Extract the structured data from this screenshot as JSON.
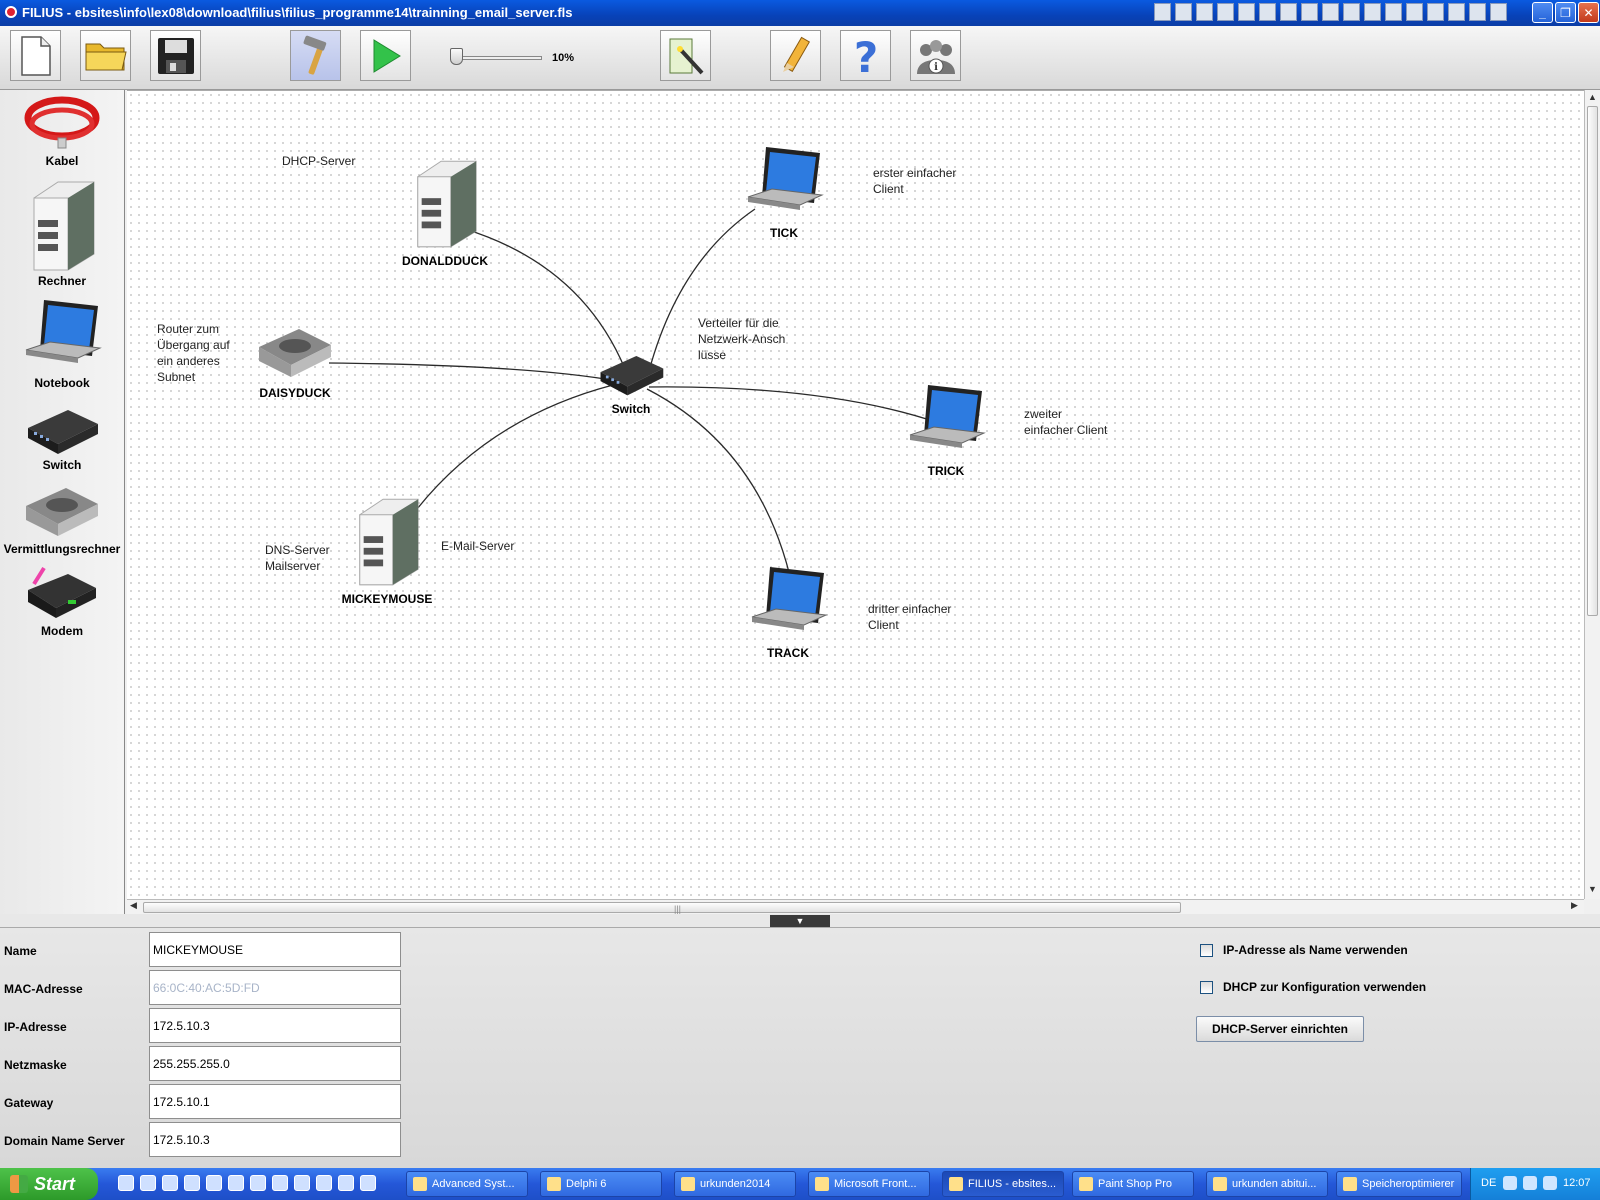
{
  "window": {
    "title": "FILIUS - ebsites\\info\\lex08\\download\\filius\\filius_programme14\\trainning_email_server.fls",
    "buttons": [
      "minimize",
      "maximize",
      "close"
    ]
  },
  "toolbar": {
    "buttons": [
      "new-file-icon",
      "open-folder-icon",
      "save-disk-icon",
      "hammer-design-mode-icon",
      "play-simulation-icon",
      "wizard-wand-icon",
      "pencil-icon",
      "help-question-icon",
      "info-people-icon"
    ],
    "speed_label": "10%",
    "speed_value": 10
  },
  "palette": {
    "items": [
      "Kabel",
      "Rechner",
      "Notebook",
      "Switch",
      "Vermittlungsrechner",
      "Modem"
    ]
  },
  "network": {
    "nodes": {
      "donaldduck": "DONALDDUCK",
      "daisyduck": "DAISYDUCK",
      "mickeymouse": "MICKEYMOUSE",
      "switch": "Switch",
      "tick": "TICK",
      "trick": "TRICK",
      "track": "TRACK"
    },
    "annotations": {
      "dhcp_server": "DHCP-Server",
      "router": "Router zum\nÜbergang auf\nein anderes\nSubnet",
      "dns_server": "DNS-Server\nMailserver",
      "email_server": "E-Mail-Server",
      "switch_note": "Verteiler für die\nNetzwerk-Ansch\nlüsse",
      "tick_note": "erster einfacher\nClient",
      "trick_note": "zweiter\neinfacher Client",
      "track_note": "dritter einfacher\nClient"
    }
  },
  "properties": {
    "name_label": "Name",
    "name_value": "MICKEYMOUSE",
    "mac_label": "MAC-Adresse",
    "mac_value": "66:0C:40:AC:5D:FD",
    "ip_label": "IP-Adresse",
    "ip_value": "172.5.10.3",
    "mask_label": "Netzmaske",
    "mask_value": "255.255.255.0",
    "gateway_label": "Gateway",
    "gateway_value": "172.5.10.1",
    "dns_label": "Domain Name Server",
    "dns_value": "172.5.10.3",
    "ip_as_name_label": "IP-Adresse als Name verwenden",
    "ip_as_name_checked": false,
    "dhcp_config_label": "DHCP zur Konfiguration verwenden",
    "dhcp_config_checked": false,
    "dhcp_setup_button": "DHCP-Server einrichten"
  },
  "taskbar": {
    "start_label": "Start",
    "tasks": [
      "Advanced Syst...",
      "Delphi 6",
      "urkunden2014",
      "Microsoft Front...",
      "FILIUS - ebsites...",
      "Paint Shop Pro",
      "urkunden abitui...",
      "Speicheroptimierer"
    ],
    "active_task": "FILIUS - ebsites...",
    "language": "DE",
    "clock": "12:07"
  },
  "colors": {
    "titlebar": "#0842b8",
    "taskbar": "#2457d8",
    "start_button": "#3aa836",
    "link": "#222222"
  }
}
